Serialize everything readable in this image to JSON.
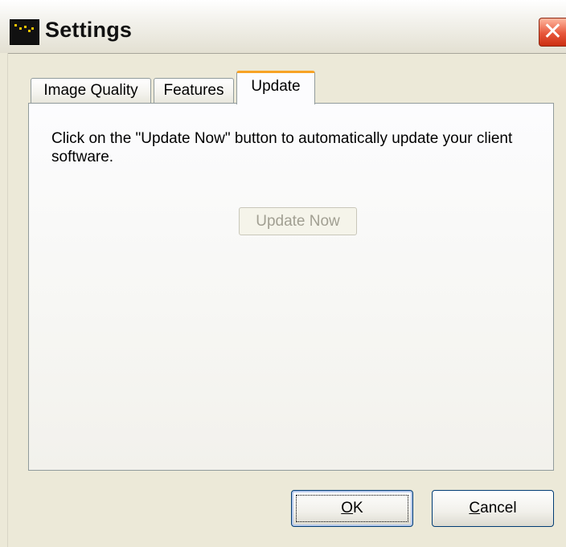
{
  "window": {
    "title": "Settings",
    "icon": "application-icon",
    "close_glyph": "✕"
  },
  "tabs": [
    {
      "label": "Image Quality",
      "active": false
    },
    {
      "label": "Features",
      "active": false
    },
    {
      "label": "Update",
      "active": true
    }
  ],
  "update_panel": {
    "description": "Click on the \"Update Now\" button to automatically update your client software.",
    "update_button": {
      "label": "Update Now",
      "enabled": false
    }
  },
  "footer": {
    "ok": {
      "mnemonic": "O",
      "rest": "K"
    },
    "cancel": {
      "mnemonic": "C",
      "rest": "ancel"
    }
  },
  "colors": {
    "dialog_bg": "#ece9d8",
    "active_tab_accent": "#f7a325",
    "close_button": "#e7573b",
    "button_border": "#003c74"
  }
}
